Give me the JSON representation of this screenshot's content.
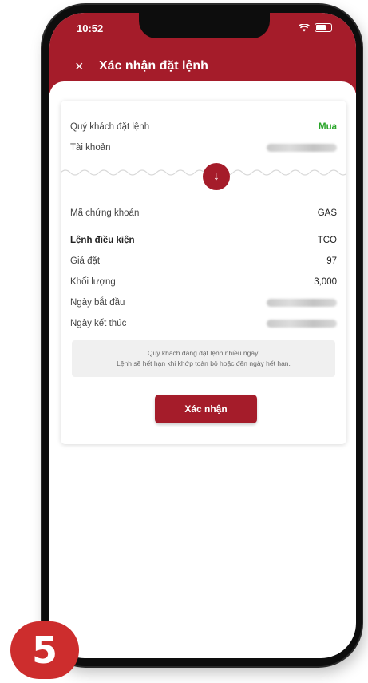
{
  "status_bar": {
    "time": "10:52"
  },
  "header": {
    "title": "Xác nhận đặt lệnh",
    "close_icon": "×"
  },
  "order": {
    "customer_label": "Quý khách đặt lệnh",
    "customer_value": "Mua",
    "account_label": "Tài khoản",
    "stock_label": "Mã chứng khoán",
    "stock_value": "GAS",
    "order_type_label": "Lệnh điều kiện",
    "order_type_value": "TCO",
    "price_label": "Giá đặt",
    "price_value": "97",
    "quantity_label": "Khối lượng",
    "quantity_value": "3,000",
    "start_date_label": "Ngày bắt đầu",
    "end_date_label": "Ngày kết thúc"
  },
  "note": {
    "line1": "Quý khách đang đặt lệnh nhiều ngày.",
    "line2": "Lệnh sẽ hết hạn khi khớp toàn bộ hoặc đến ngày hết hạn."
  },
  "confirm_button": "Xác nhận",
  "step_badge": "5",
  "colors": {
    "brand_red": "#a51c2a",
    "buy_green": "#2aa52a",
    "badge_red": "#cd2d2d"
  }
}
